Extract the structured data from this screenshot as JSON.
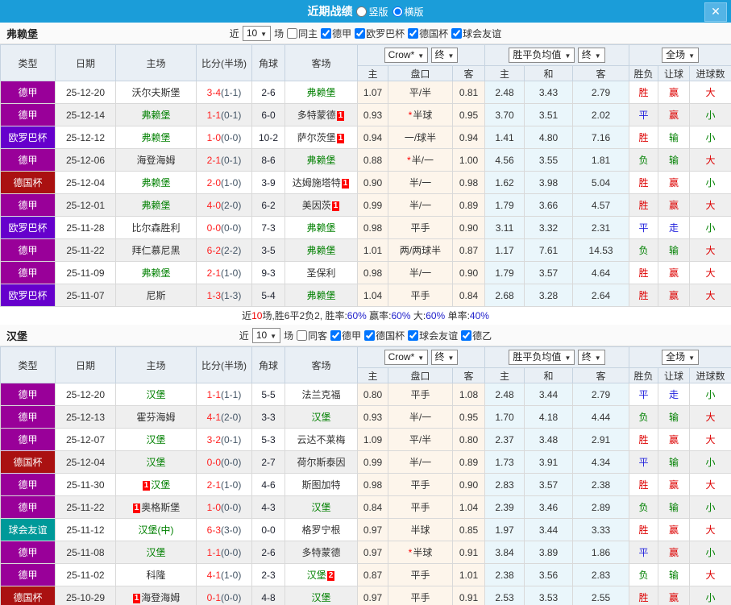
{
  "titlebar": {
    "title": "近期战绩",
    "vertical_label": "竖版",
    "horizontal_label": "横版",
    "selected_layout": "横版",
    "close_label": "✕"
  },
  "columns": {
    "type": "类型",
    "date": "日期",
    "home": "主场",
    "score": "比分(半场)",
    "corner": "角球",
    "away": "客场",
    "dd_crow": "Crow*",
    "dd_final1": "终",
    "dd_avg": "胜平负均值",
    "dd_final2": "终",
    "dd_scope": "全场",
    "sub": [
      "主",
      "盘口",
      "客",
      "主",
      "和",
      "客",
      "胜负",
      "让球",
      "进球数"
    ]
  },
  "colors": {
    "titlebar_bg": "#1b9dd9",
    "type": {
      "德甲": "#990099",
      "欧罗巴杯": "#6600cc",
      "德国杯": "#aa1111",
      "球会友谊": "#009999"
    },
    "result": {
      "胜": "#dd0000",
      "赢": "#dd0000",
      "大": "#dd0000",
      "平": "#2222dd",
      "走": "#2222dd",
      "负": "#008000",
      "输": "#008000",
      "小": "#008000"
    },
    "self_team": "#008000",
    "score": "#ff2222",
    "badge_bg": "#ff0000"
  },
  "teams": [
    {
      "name": "弗赖堡",
      "filter": {
        "near_label": "近",
        "count": "10",
        "games_label": "场",
        "same_label": "同主",
        "leagues": [
          "德甲",
          "欧罗巴杯",
          "德国杯",
          "球会友谊"
        ]
      },
      "rows": [
        {
          "type": "德甲",
          "date": "25-12-20",
          "home": "沃尔夫斯堡",
          "home_self": false,
          "score": "3-4",
          "half": "(1-1)",
          "corner": "2-6",
          "away": "弗赖堡",
          "away_self": true,
          "h": "1.07",
          "pan": "平/半",
          "pan_star": false,
          "a": "0.81",
          "w": "2.48",
          "d": "3.43",
          "l": "2.79",
          "r_wdl": "胜",
          "r_handicap": "赢",
          "r_goals": "大"
        },
        {
          "type": "德甲",
          "date": "25-12-14",
          "home": "弗赖堡",
          "home_self": true,
          "score": "1-1",
          "half": "(0-1)",
          "corner": "6-0",
          "away": "多特蒙德",
          "away_self": false,
          "away_badge": "1",
          "away_badge_pos": "after",
          "h": "0.93",
          "pan": "半球",
          "pan_star": true,
          "a": "0.95",
          "w": "3.70",
          "d": "3.51",
          "l": "2.02",
          "r_wdl": "平",
          "r_handicap": "赢",
          "r_goals": "小"
        },
        {
          "type": "欧罗巴杯",
          "date": "25-12-12",
          "home": "弗赖堡",
          "home_self": true,
          "score": "1-0",
          "half": "(0-0)",
          "corner": "10-2",
          "away": "萨尔茨堡",
          "away_self": false,
          "away_badge": "1",
          "away_badge_pos": "after",
          "h": "0.94",
          "pan": "一/球半",
          "pan_star": false,
          "a": "0.94",
          "w": "1.41",
          "d": "4.80",
          "l": "7.16",
          "r_wdl": "胜",
          "r_handicap": "输",
          "r_goals": "小"
        },
        {
          "type": "德甲",
          "date": "25-12-06",
          "home": "海登海姆",
          "home_self": false,
          "score": "2-1",
          "half": "(0-1)",
          "corner": "8-6",
          "away": "弗赖堡",
          "away_self": true,
          "h": "0.88",
          "pan": "半/一",
          "pan_star": true,
          "a": "1.00",
          "w": "4.56",
          "d": "3.55",
          "l": "1.81",
          "r_wdl": "负",
          "r_handicap": "输",
          "r_goals": "大"
        },
        {
          "type": "德国杯",
          "date": "25-12-04",
          "home": "弗赖堡",
          "home_self": true,
          "score": "2-0",
          "half": "(1-0)",
          "corner": "3-9",
          "away": "达姆施塔特",
          "away_self": false,
          "away_badge": "1",
          "away_badge_pos": "after",
          "h": "0.90",
          "pan": "半/一",
          "pan_star": false,
          "a": "0.98",
          "w": "1.62",
          "d": "3.98",
          "l": "5.04",
          "r_wdl": "胜",
          "r_handicap": "赢",
          "r_goals": "小"
        },
        {
          "type": "德甲",
          "date": "25-12-01",
          "home": "弗赖堡",
          "home_self": true,
          "score": "4-0",
          "half": "(2-0)",
          "corner": "6-2",
          "away": "美因茨",
          "away_self": false,
          "away_badge": "1",
          "away_badge_pos": "after",
          "h": "0.99",
          "pan": "半/一",
          "pan_star": false,
          "a": "0.89",
          "w": "1.79",
          "d": "3.66",
          "l": "4.57",
          "r_wdl": "胜",
          "r_handicap": "赢",
          "r_goals": "大"
        },
        {
          "type": "欧罗巴杯",
          "date": "25-11-28",
          "home": "比尔森胜利",
          "home_self": false,
          "score": "0-0",
          "half": "(0-0)",
          "corner": "7-3",
          "away": "弗赖堡",
          "away_self": true,
          "h": "0.98",
          "pan": "平手",
          "pan_star": false,
          "a": "0.90",
          "w": "3.11",
          "d": "3.32",
          "l": "2.31",
          "r_wdl": "平",
          "r_handicap": "走",
          "r_goals": "小"
        },
        {
          "type": "德甲",
          "date": "25-11-22",
          "home": "拜仁慕尼黑",
          "home_self": false,
          "score": "6-2",
          "half": "(2-2)",
          "corner": "3-5",
          "away": "弗赖堡",
          "away_self": true,
          "h": "1.01",
          "pan": "两/两球半",
          "pan_star": false,
          "a": "0.87",
          "w": "1.17",
          "d": "7.61",
          "l": "14.53",
          "r_wdl": "负",
          "r_handicap": "输",
          "r_goals": "大"
        },
        {
          "type": "德甲",
          "date": "25-11-09",
          "home": "弗赖堡",
          "home_self": true,
          "score": "2-1",
          "half": "(1-0)",
          "corner": "9-3",
          "away": "圣保利",
          "away_self": false,
          "h": "0.98",
          "pan": "半/一",
          "pan_star": false,
          "a": "0.90",
          "w": "1.79",
          "d": "3.57",
          "l": "4.64",
          "r_wdl": "胜",
          "r_handicap": "赢",
          "r_goals": "大"
        },
        {
          "type": "欧罗巴杯",
          "date": "25-11-07",
          "home": "尼斯",
          "home_self": false,
          "score": "1-3",
          "half": "(1-3)",
          "corner": "5-4",
          "away": "弗赖堡",
          "away_self": true,
          "h": "1.04",
          "pan": "平手",
          "pan_star": false,
          "a": "0.84",
          "w": "2.68",
          "d": "3.28",
          "l": "2.64",
          "r_wdl": "胜",
          "r_handicap": "赢",
          "r_goals": "大"
        }
      ],
      "summary": [
        {
          "text": "近",
          "color": "#333333"
        },
        {
          "text": "10",
          "color": "#ee0000"
        },
        {
          "text": "场,胜6平2负2, 胜率:",
          "color": "#333333"
        },
        {
          "text": "60%",
          "color": "#2222cc"
        },
        {
          "text": " 赢率:",
          "color": "#333333"
        },
        {
          "text": "60%",
          "color": "#2222cc"
        },
        {
          "text": " 大:",
          "color": "#333333"
        },
        {
          "text": "60%",
          "color": "#2222cc"
        },
        {
          "text": " 单率:",
          "color": "#333333"
        },
        {
          "text": "40%",
          "color": "#2222cc"
        }
      ]
    },
    {
      "name": "汉堡",
      "filter": {
        "near_label": "近",
        "count": "10",
        "games_label": "场",
        "same_label": "同客",
        "leagues": [
          "德甲",
          "德国杯",
          "球会友谊",
          "德乙"
        ]
      },
      "rows": [
        {
          "type": "德甲",
          "date": "25-12-20",
          "home": "汉堡",
          "home_self": true,
          "score": "1-1",
          "half": "(1-1)",
          "corner": "5-5",
          "away": "法兰克福",
          "away_self": false,
          "h": "0.80",
          "pan": "平手",
          "pan_star": false,
          "a": "1.08",
          "w": "2.48",
          "d": "3.44",
          "l": "2.79",
          "r_wdl": "平",
          "r_handicap": "走",
          "r_goals": "小"
        },
        {
          "type": "德甲",
          "date": "25-12-13",
          "home": "霍芬海姆",
          "home_self": false,
          "score": "4-1",
          "half": "(2-0)",
          "corner": "3-3",
          "away": "汉堡",
          "away_self": true,
          "h": "0.93",
          "pan": "半/一",
          "pan_star": false,
          "a": "0.95",
          "w": "1.70",
          "d": "4.18",
          "l": "4.44",
          "r_wdl": "负",
          "r_handicap": "输",
          "r_goals": "大"
        },
        {
          "type": "德甲",
          "date": "25-12-07",
          "home": "汉堡",
          "home_self": true,
          "score": "3-2",
          "half": "(0-1)",
          "corner": "5-3",
          "away": "云达不莱梅",
          "away_self": false,
          "h": "1.09",
          "pan": "平/半",
          "pan_star": false,
          "a": "0.80",
          "w": "2.37",
          "d": "3.48",
          "l": "2.91",
          "r_wdl": "胜",
          "r_handicap": "赢",
          "r_goals": "大"
        },
        {
          "type": "德国杯",
          "date": "25-12-04",
          "home": "汉堡",
          "home_self": true,
          "score": "0-0",
          "half": "(0-0)",
          "corner": "2-7",
          "away": "荷尔斯泰因",
          "away_self": false,
          "h": "0.99",
          "pan": "半/一",
          "pan_star": false,
          "a": "0.89",
          "w": "1.73",
          "d": "3.91",
          "l": "4.34",
          "r_wdl": "平",
          "r_handicap": "输",
          "r_goals": "小"
        },
        {
          "type": "德甲",
          "date": "25-11-30",
          "home": "汉堡",
          "home_self": true,
          "home_badge": "1",
          "home_badge_pos": "before",
          "score": "2-1",
          "half": "(1-0)",
          "corner": "4-6",
          "away": "斯图加特",
          "away_self": false,
          "h": "0.98",
          "pan": "平手",
          "pan_star": false,
          "a": "0.90",
          "w": "2.83",
          "d": "3.57",
          "l": "2.38",
          "r_wdl": "胜",
          "r_handicap": "赢",
          "r_goals": "大"
        },
        {
          "type": "德甲",
          "date": "25-11-22",
          "home": "奥格斯堡",
          "home_self": false,
          "home_badge": "1",
          "home_badge_pos": "before",
          "score": "1-0",
          "half": "(0-0)",
          "corner": "4-3",
          "away": "汉堡",
          "away_self": true,
          "h": "0.84",
          "pan": "平手",
          "pan_star": false,
          "a": "1.04",
          "w": "2.39",
          "d": "3.46",
          "l": "2.89",
          "r_wdl": "负",
          "r_handicap": "输",
          "r_goals": "小"
        },
        {
          "type": "球会友谊",
          "date": "25-11-12",
          "home": "汉堡(中)",
          "home_self": true,
          "score": "6-3",
          "half": "(3-0)",
          "corner": "0-0",
          "away": "格罗宁根",
          "away_self": false,
          "h": "0.97",
          "pan": "半球",
          "pan_star": false,
          "a": "0.85",
          "w": "1.97",
          "d": "3.44",
          "l": "3.33",
          "r_wdl": "胜",
          "r_handicap": "赢",
          "r_goals": "大"
        },
        {
          "type": "德甲",
          "date": "25-11-08",
          "home": "汉堡",
          "home_self": true,
          "score": "1-1",
          "half": "(0-0)",
          "corner": "2-6",
          "away": "多特蒙德",
          "away_self": false,
          "h": "0.97",
          "pan": "半球",
          "pan_star": true,
          "a": "0.91",
          "w": "3.84",
          "d": "3.89",
          "l": "1.86",
          "r_wdl": "平",
          "r_handicap": "赢",
          "r_goals": "小"
        },
        {
          "type": "德甲",
          "date": "25-11-02",
          "home": "科隆",
          "home_self": false,
          "score": "4-1",
          "half": "(1-0)",
          "corner": "2-3",
          "away": "汉堡",
          "away_self": true,
          "away_badge": "2",
          "away_badge_pos": "after",
          "h": "0.87",
          "pan": "平手",
          "pan_star": false,
          "a": "1.01",
          "w": "2.38",
          "d": "3.56",
          "l": "2.83",
          "r_wdl": "负",
          "r_handicap": "输",
          "r_goals": "大"
        },
        {
          "type": "德国杯",
          "date": "25-10-29",
          "home": "海登海姆",
          "home_self": false,
          "home_badge": "1",
          "home_badge_pos": "before",
          "score": "0-1",
          "half": "(0-0)",
          "corner": "4-8",
          "away": "汉堡",
          "away_self": true,
          "h": "0.97",
          "pan": "平手",
          "pan_star": false,
          "a": "0.91",
          "w": "2.53",
          "d": "3.53",
          "l": "2.55",
          "r_wdl": "胜",
          "r_handicap": "赢",
          "r_goals": "小"
        }
      ]
    }
  ]
}
